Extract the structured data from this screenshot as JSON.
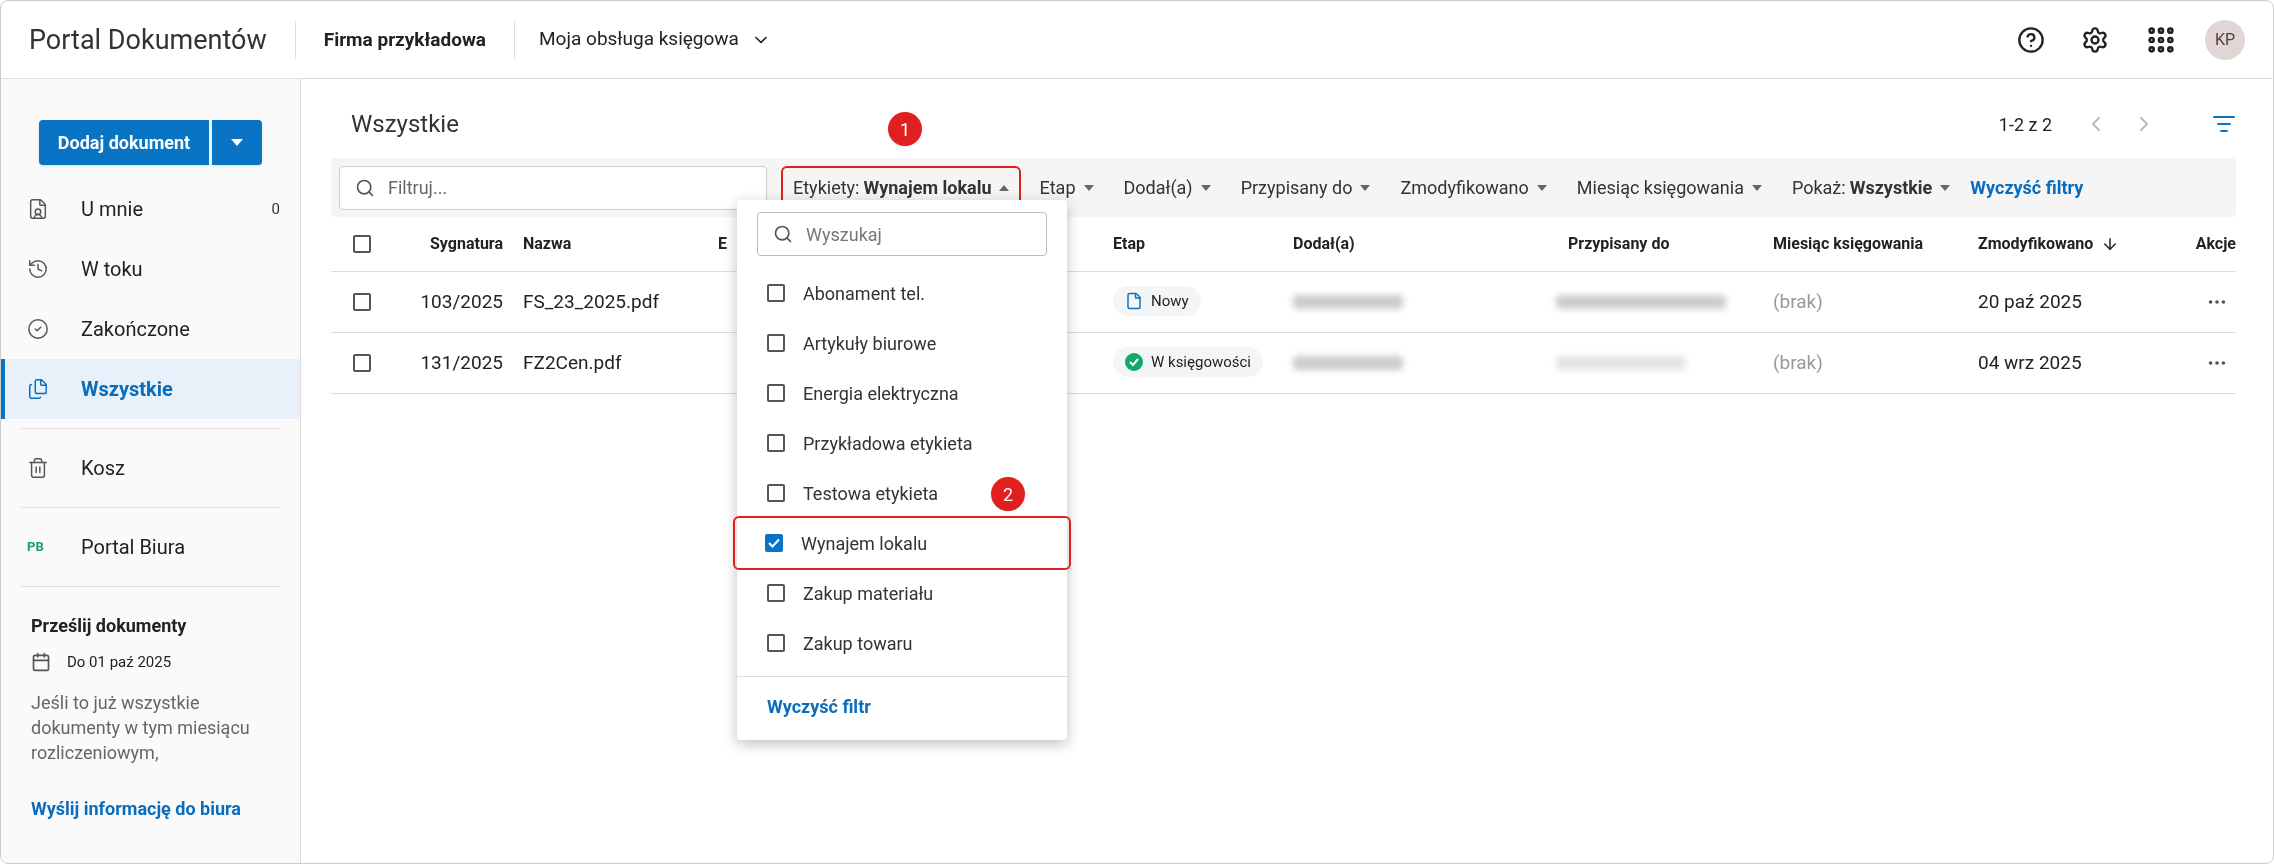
{
  "header": {
    "app_title": "Portal Dokumentów",
    "company": "Firma przykładowa",
    "service": "Moja obsługa księgowa",
    "avatar": "KP"
  },
  "sidebar": {
    "add_button": "Dodaj dokument",
    "items": [
      {
        "kind": "mine",
        "label": "U mnie",
        "count": "0",
        "selected": false
      },
      {
        "kind": "progress",
        "label": "W toku",
        "selected": false
      },
      {
        "kind": "done",
        "label": "Zakończone",
        "selected": false
      },
      {
        "kind": "all",
        "label": "Wszystkie",
        "selected": true
      },
      {
        "kind": "trash",
        "label": "Kosz",
        "selected": false
      },
      {
        "kind": "portal",
        "badge": "PB",
        "label": "Portal Biura",
        "selected": false
      }
    ],
    "upload": {
      "title": "Prześlij dokumenty",
      "deadline": "Do 01 paź 2025",
      "text": "Jeśli to już wszystkie dokumenty w tym miesiącu rozliczeniowym,",
      "link": "Wyślij informację do biura"
    }
  },
  "main": {
    "title": "Wszystkie",
    "pagination": "1-2 z 2",
    "filter_placeholder": "Filtruj...",
    "filters": [
      {
        "label": "Etykiety:",
        "value": "Wynajem lokalu",
        "expanded": true
      },
      {
        "label": "Etap",
        "expanded": false
      },
      {
        "label": "Dodał(a)",
        "expanded": false
      },
      {
        "label": "Przypisany do",
        "expanded": false
      },
      {
        "label": "Zmodyfikowano",
        "expanded": false
      },
      {
        "label": "Miesiąc księgowania",
        "expanded": false
      },
      {
        "label": "Pokaż:",
        "value": "Wszystkie",
        "expanded": false
      }
    ],
    "clear_filters": "Wyczyść filtry",
    "table": {
      "select_all_checked": false,
      "columns": [
        "Sygnatura",
        "Nazwa",
        "E",
        "Etap",
        "Dodał(a)",
        "Przypisany do",
        "Miesiąc księgowania",
        "Zmodyfikowano",
        "Akcje"
      ],
      "rows": [
        {
          "checked": false,
          "signature": "103/2025",
          "name": "FS_23_2025.pdf",
          "stage": {
            "kind": "new",
            "label": "Nowy"
          },
          "month": "(brak)",
          "modified": "20 paź 2025"
        },
        {
          "checked": false,
          "signature": "131/2025",
          "name": "FZ2Cen.pdf",
          "stage": {
            "kind": "accounting",
            "label": "W księgowości"
          },
          "month": "(brak)",
          "modified": "04 wrz 2025"
        }
      ]
    },
    "dropdown": {
      "search_placeholder": "Wyszukaj",
      "options": [
        {
          "label": "Abonament tel.",
          "checked": false
        },
        {
          "label": "Artykuły biurowe",
          "checked": false
        },
        {
          "label": "Energia elektryczna",
          "checked": false
        },
        {
          "label": "Przykładowa etykieta",
          "checked": false
        },
        {
          "label": "Testowa etykieta",
          "checked": false
        },
        {
          "label": "Wynajem lokalu",
          "checked": true
        },
        {
          "label": "Zakup materiału",
          "checked": false
        },
        {
          "label": "Zakup towaru",
          "checked": false
        }
      ],
      "clear": "Wyczyść filtr"
    }
  },
  "callouts": [
    "1",
    "2"
  ]
}
